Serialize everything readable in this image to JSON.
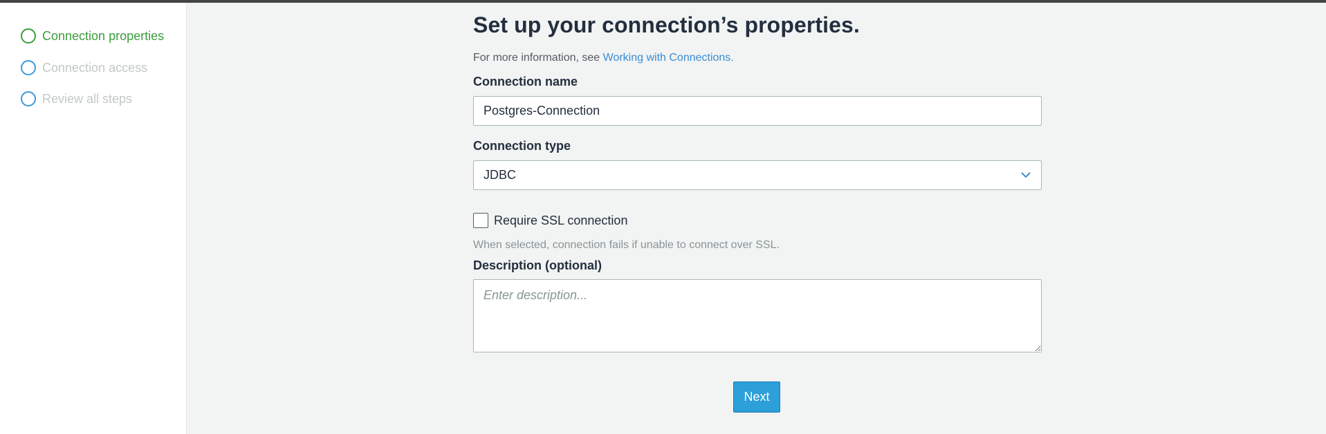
{
  "sidebar": {
    "steps": [
      {
        "label": "Connection properties",
        "state": "active"
      },
      {
        "label": "Connection access",
        "state": "inactive"
      },
      {
        "label": "Review all steps",
        "state": "inactive"
      }
    ]
  },
  "main": {
    "title": "Set up your connection’s properties.",
    "info_prefix": "For more information, see ",
    "info_link": "Working with Connections.",
    "connection_name": {
      "label": "Connection name",
      "value": "Postgres-Connection"
    },
    "connection_type": {
      "label": "Connection type",
      "value": "JDBC",
      "icon": "chevron-down-icon"
    },
    "ssl": {
      "label": "Require SSL connection",
      "checked": false,
      "hint": "When selected, connection fails if unable to connect over SSL."
    },
    "description": {
      "label": "Description (optional)",
      "placeholder": "Enter description..."
    },
    "next_label": "Next"
  },
  "colors": {
    "active_step": "#3a9c3d",
    "inactive_step_ring": "#3b9ad8",
    "inactive_step_text": "#c2c7c9",
    "link": "#3b8cd1",
    "primary_button": "#2d9fd9",
    "page_background": "#f2f3f3"
  }
}
